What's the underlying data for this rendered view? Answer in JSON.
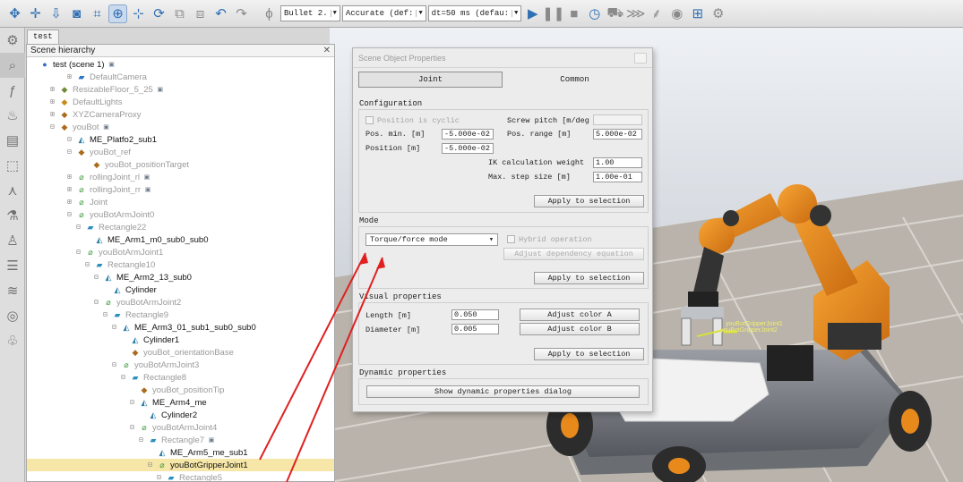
{
  "toolbar": {
    "engine_combo": "Bullet 2.",
    "accuracy_combo": "Accurate (def:",
    "dt_combo": "dt=50 ms (defau:"
  },
  "scene_tab": "test",
  "hierarchy": {
    "title": "Scene hierarchy",
    "close": "✕",
    "rows": [
      {
        "label": "test (scene 1)",
        "dim": false
      },
      {
        "label": "DefaultCamera",
        "dim": true
      },
      {
        "label": "ResizableFloor_5_25",
        "dim": true
      },
      {
        "label": "DefaultLights",
        "dim": true
      },
      {
        "label": "XYZCameraProxy",
        "dim": true
      },
      {
        "label": "youBot",
        "dim": true
      },
      {
        "label": "ME_Platfo2_sub1",
        "dim": false
      },
      {
        "label": "youBot_ref",
        "dim": true
      },
      {
        "label": "youBot_positionTarget",
        "dim": true
      },
      {
        "label": "rollingJoint_rl",
        "dim": true
      },
      {
        "label": "rollingJoint_rr",
        "dim": true
      },
      {
        "label": "Joint",
        "dim": true
      },
      {
        "label": "youBotArmJoint0",
        "dim": true
      },
      {
        "label": "Rectangle22",
        "dim": true
      },
      {
        "label": "ME_Arm1_m0_sub0_sub0",
        "dim": false
      },
      {
        "label": "youBotArmJoint1",
        "dim": true
      },
      {
        "label": "Rectangle10",
        "dim": true
      },
      {
        "label": "ME_Arm2_13_sub0",
        "dim": false
      },
      {
        "label": "Cylinder",
        "dim": false
      },
      {
        "label": "youBotArmJoint2",
        "dim": true
      },
      {
        "label": "Rectangle9",
        "dim": true
      },
      {
        "label": "ME_Arm3_01_sub1_sub0_sub0",
        "dim": false
      },
      {
        "label": "Cylinder1",
        "dim": false
      },
      {
        "label": "youBot_orientationBase",
        "dim": true
      },
      {
        "label": "youBotArmJoint3",
        "dim": true
      },
      {
        "label": "Rectangle8",
        "dim": true
      },
      {
        "label": "youBot_positionTip",
        "dim": true
      },
      {
        "label": "ME_Arm4_me",
        "dim": false
      },
      {
        "label": "Cylinder2",
        "dim": false
      },
      {
        "label": "youBotArmJoint4",
        "dim": true
      },
      {
        "label": "Rectangle7",
        "dim": true
      },
      {
        "label": "ME_Arm5_me_sub1",
        "dim": false
      },
      {
        "label": "youBotGripperJoint1",
        "dim": false
      },
      {
        "label": "Rectangle5",
        "dim": true
      }
    ]
  },
  "dialog": {
    "title": "Scene Object Properties",
    "tab_joint": "Joint",
    "tab_common": "Common",
    "configuration": {
      "title": "Configuration",
      "cyclic_label": "Position is cyclic",
      "pitch_label": "Screw pitch [m/deg",
      "pitch_value": "",
      "pos_min_label": "Pos. min. [m]",
      "pos_min_value": "-5.000e-02",
      "pos_range_label": "Pos. range [m]",
      "pos_range_value": "5.000e-02",
      "position_label": "Position [m]",
      "position_value": "-5.000e-02",
      "ik_weight_label": "IK calculation weight",
      "ik_weight_value": "1.00",
      "max_step_label": "Max. step size [m]",
      "max_step_value": "1.00e-01",
      "apply": "Apply to selection"
    },
    "mode": {
      "title": "Mode",
      "selected": "Torque/force mode",
      "hybrid_label": "Hybrid operation",
      "adjust_dep": "Adjust dependency equation",
      "apply": "Apply to selection"
    },
    "visual": {
      "title": "Visual properties",
      "length_label": "Length [m]",
      "length_value": "0.050",
      "diameter_label": "Diameter [m]",
      "diameter_value": "0.005",
      "color_a": "Adjust color A",
      "color_b": "Adjust color B",
      "apply": "Apply to selection"
    },
    "dynamic": {
      "title": "Dynamic properties",
      "show": "Show dynamic properties dialog"
    }
  },
  "viewport": {
    "label1": "youBotGripperJoint1",
    "label2": "youBotGripperJoint2"
  },
  "colors": {
    "robot_orange": "#e8891c",
    "selection_yellow": "#f6e7a8",
    "annotation_red": "#e02020"
  }
}
